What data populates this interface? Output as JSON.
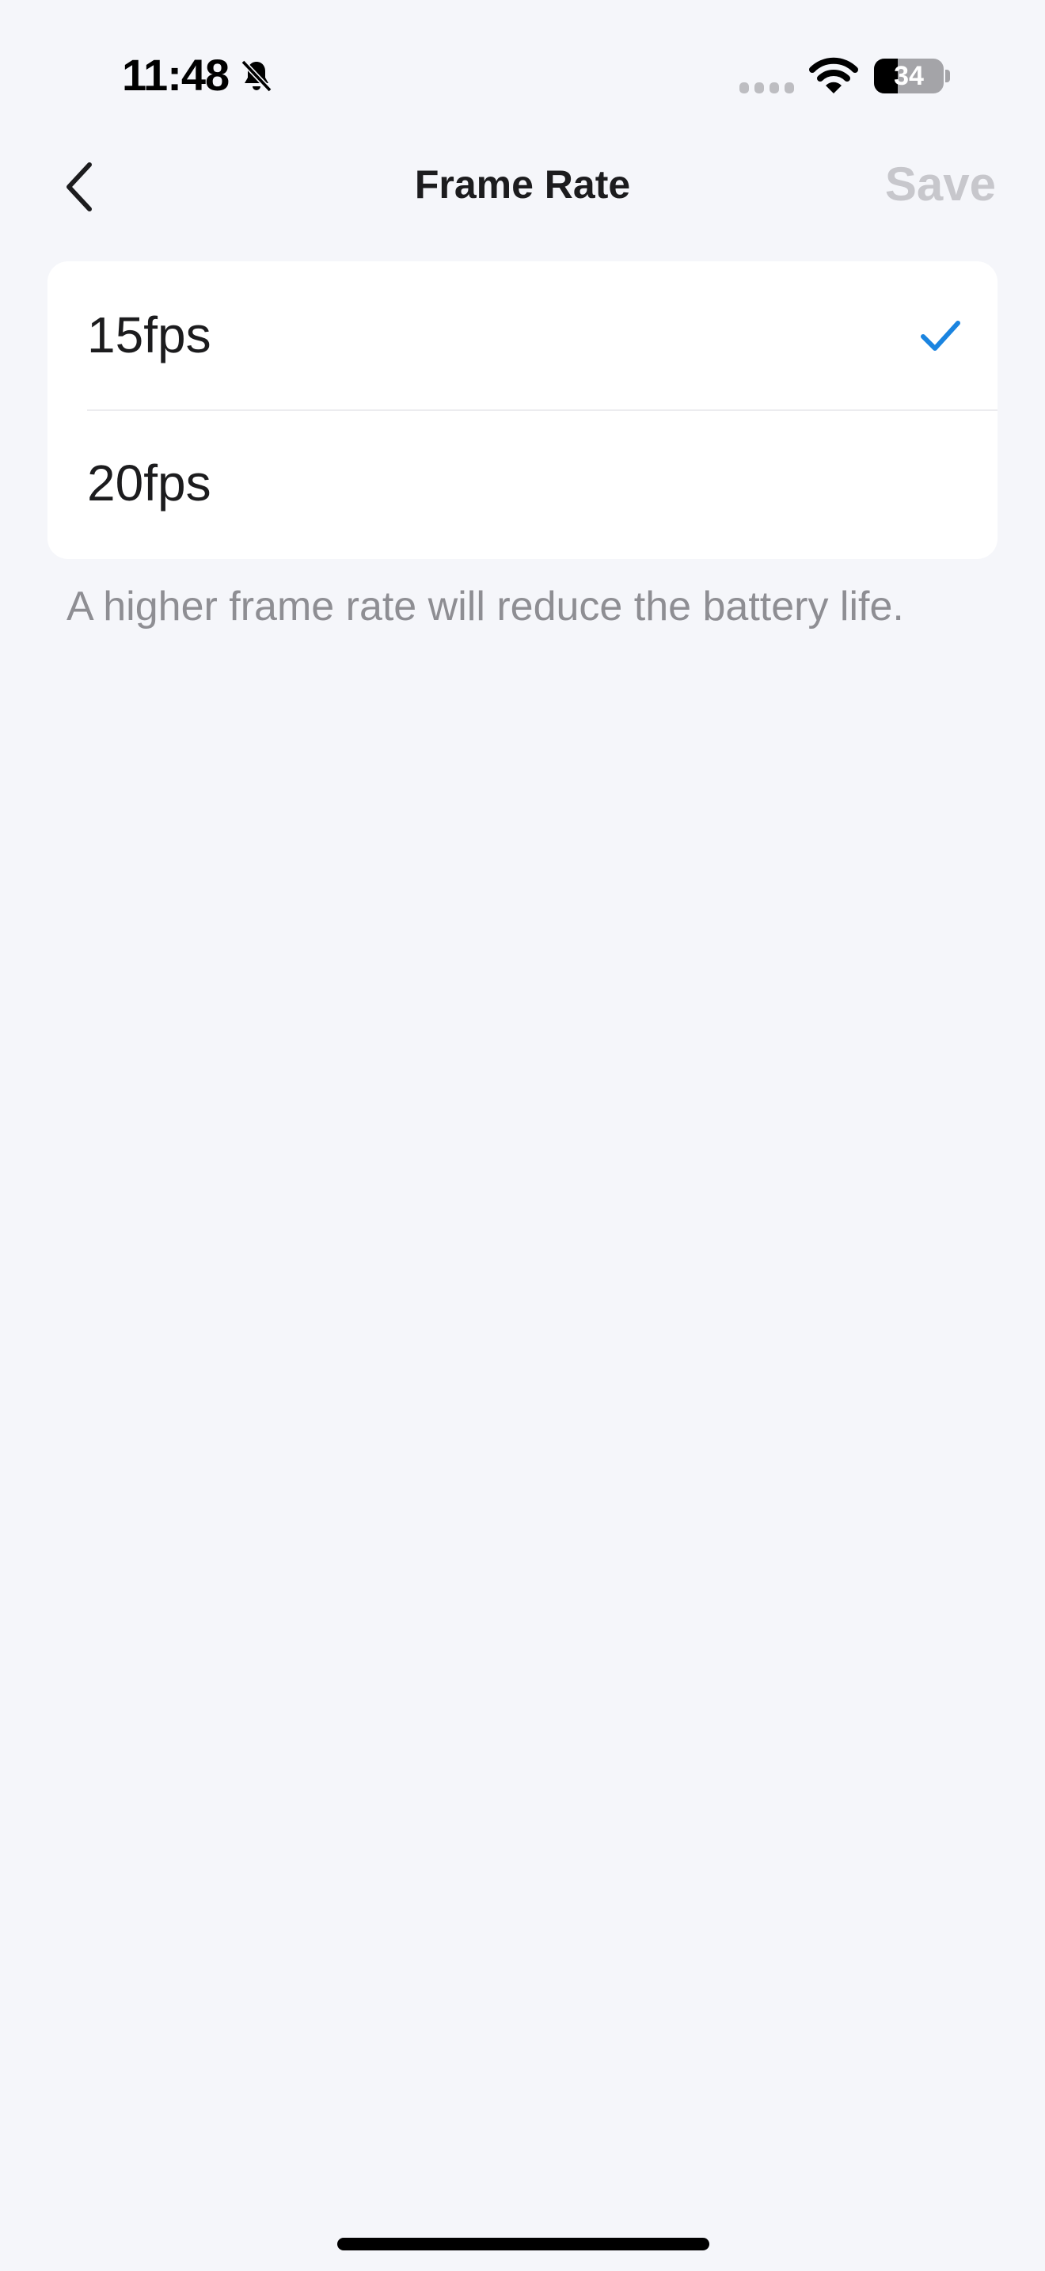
{
  "status_bar": {
    "time": "11:48",
    "battery_text": "34",
    "battery_level": 0.34,
    "icons": [
      "bell-slash-icon",
      "cellular-signal-icon",
      "wifi-icon",
      "battery-icon"
    ]
  },
  "nav": {
    "back_icon": "chevron-left-icon",
    "title": "Frame Rate",
    "save_label": "Save"
  },
  "options": [
    {
      "label": "15fps",
      "selected": true
    },
    {
      "label": "20fps",
      "selected": false
    }
  ],
  "hint": "A higher frame rate will reduce the battery life.",
  "colors": {
    "background": "#f5f6fa",
    "card": "#ffffff",
    "accent": "#1a84e0",
    "disabled_text": "#c7c7cc",
    "secondary_text": "#8e8e93"
  }
}
